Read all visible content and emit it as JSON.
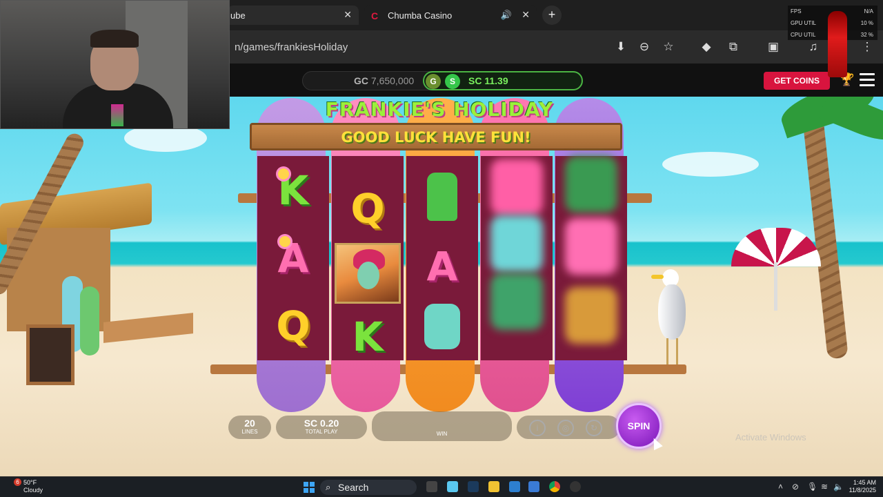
{
  "browser": {
    "tabs": [
      {
        "title": "ube",
        "active": false
      },
      {
        "title": "Chumba Casino",
        "active": true
      }
    ],
    "new_tab_glyph": "+",
    "url": "n/games/frankiesHoliday",
    "toolbar_icons": [
      "install-icon",
      "zoom-out-icon",
      "star-icon",
      "extension-diamond-icon",
      "puzzle-icon",
      "screen-search-icon",
      "media-icon",
      "more-icon"
    ]
  },
  "site": {
    "gc_label": "GC",
    "gc_value": "7,650,000",
    "coin_g": "G",
    "coin_s": "S",
    "sc_label": "SC",
    "sc_value": "11.39",
    "get_coins": "GET COINS"
  },
  "game": {
    "title": "FRANKIE'S HOLIDAY",
    "tagline": "GOOD LUCK HAVE FUN!",
    "reels": [
      [
        "K",
        "A",
        "Q"
      ],
      [
        "Q",
        "wild",
        "K"
      ],
      [
        "hand",
        "A",
        "zombie"
      ],
      [
        "blur",
        "blur",
        "blur"
      ],
      [
        "blur",
        "blur",
        "blur"
      ]
    ],
    "lines_value": "20",
    "lines_label": "LINES",
    "total_play_value": "SC 0.20",
    "total_play_label": "TOTAL PLAY",
    "win_label": "WIN",
    "spin_label": "SPIN",
    "colors": {
      "accent": "#d8143e",
      "sc_green": "#7af05e",
      "spin_purple": "#8a22c8"
    }
  },
  "overlay": {
    "perf": [
      {
        "label": "FPS",
        "value": "N/A"
      },
      {
        "label": "GPU UTIL",
        "value": "10 %"
      },
      {
        "label": "CPU UTIL",
        "value": "32 %"
      }
    ],
    "watermark": "Activate Windows"
  },
  "taskbar": {
    "notification_count": "6",
    "temperature": "50°F",
    "condition": "Cloudy",
    "search_placeholder": "Search",
    "time": "1:45 AM",
    "date": "11/8/2025"
  }
}
